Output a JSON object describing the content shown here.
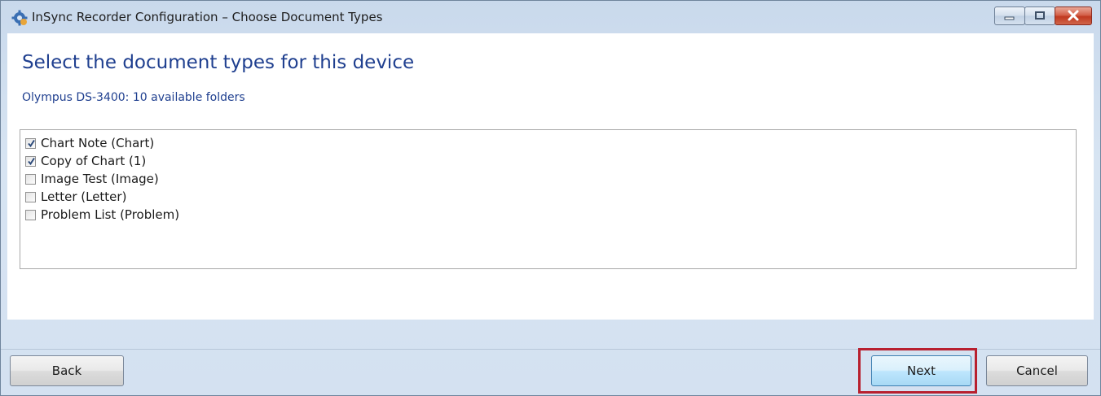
{
  "window": {
    "title": "InSync Recorder Configuration – Choose Document Types"
  },
  "icons": {
    "app": "gear-icon",
    "minimize": "minimize-icon",
    "maximize": "maximize-icon",
    "close": "close-icon",
    "checkmark": "checkmark-icon"
  },
  "main": {
    "heading": "Select the document types for this device",
    "subheading": "Olympus DS-3400: 10 available folders",
    "document_types": [
      {
        "label": "Chart Note (Chart)",
        "checked": true
      },
      {
        "label": "Copy of Chart (1)",
        "checked": true
      },
      {
        "label": "Image Test (Image)",
        "checked": false
      },
      {
        "label": "Letter (Letter)",
        "checked": false
      },
      {
        "label": "Problem List (Problem)",
        "checked": false
      }
    ]
  },
  "footer": {
    "back_label": "Back",
    "next_label": "Next",
    "cancel_label": "Cancel"
  },
  "colors": {
    "heading": "#1f3f8f",
    "highlight": "#b8202f",
    "close_button": "#c0391f"
  }
}
